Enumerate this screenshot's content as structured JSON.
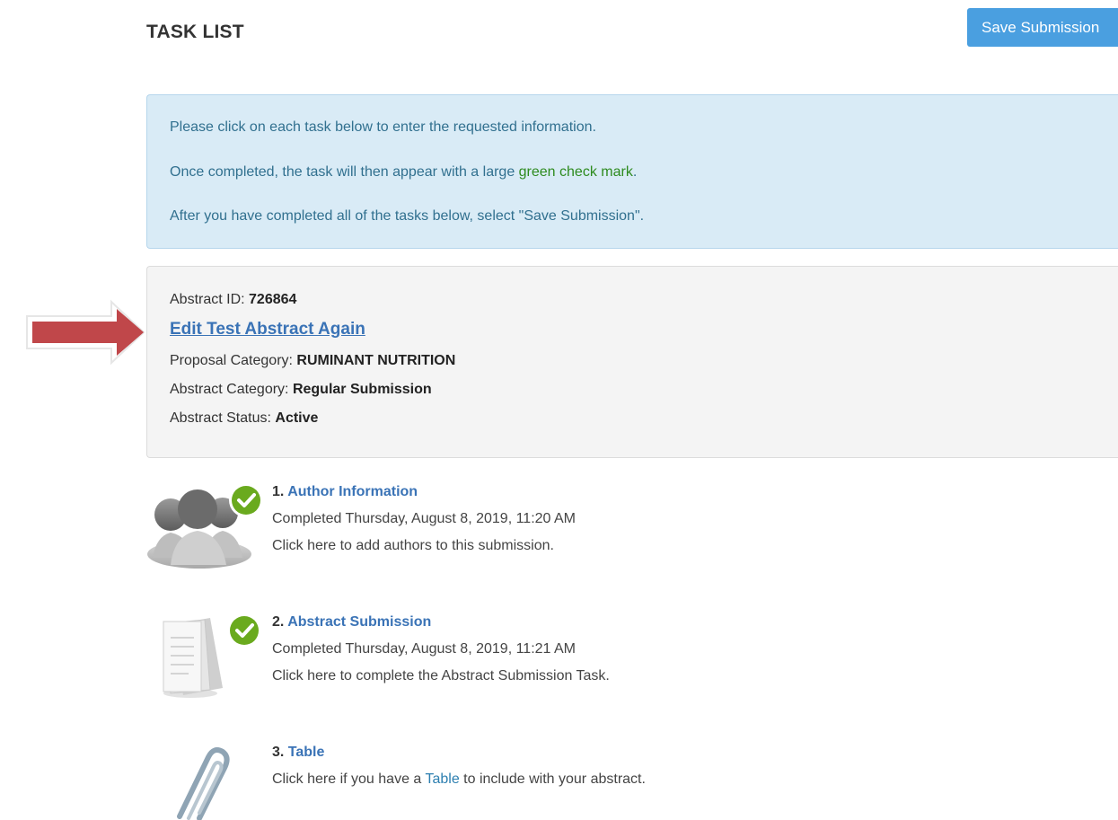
{
  "header": {
    "title": "TASK LIST",
    "save_button": "Save Submission"
  },
  "info": {
    "line1": "Please click on each task below to enter the requested information.",
    "line2_pre": "Once completed, the task will then appear with a large ",
    "line2_green": "green check mark",
    "line2_post": ".",
    "line3": "After you have completed all of the tasks below, select \"Save Submission\"."
  },
  "abstract": {
    "id_label": "Abstract ID:",
    "id_value": "726864",
    "title": "Edit Test Abstract Again",
    "proposal_label": "Proposal Category:",
    "proposal_value": "RUMINANT NUTRITION",
    "category_label": "Abstract Category:",
    "category_value": "Regular Submission",
    "status_label": "Abstract Status:",
    "status_value": "Active"
  },
  "tasks": [
    {
      "number": "1.",
      "title": "Author Information",
      "completed": "Completed Thursday, August 8, 2019, 11:20 AM",
      "description": "Click here to add authors to this submission.",
      "icon": "people-icon",
      "done": true
    },
    {
      "number": "2.",
      "title": "Abstract Submission",
      "completed": "Completed Thursday, August 8, 2019, 11:21 AM",
      "description": "Click here to complete the Abstract Submission Task.",
      "icon": "documents-icon",
      "done": true
    },
    {
      "number": "3.",
      "title": "Table",
      "desc_pre": "Click here if you have a ",
      "desc_link": "Table",
      "desc_post": " to include with your abstract.",
      "icon": "paperclip-icon",
      "done": false
    }
  ],
  "colors": {
    "accent": "#4a9fe0",
    "link": "#3a73b6",
    "check": "#6aaa1e",
    "arrow": "#c0392b"
  }
}
